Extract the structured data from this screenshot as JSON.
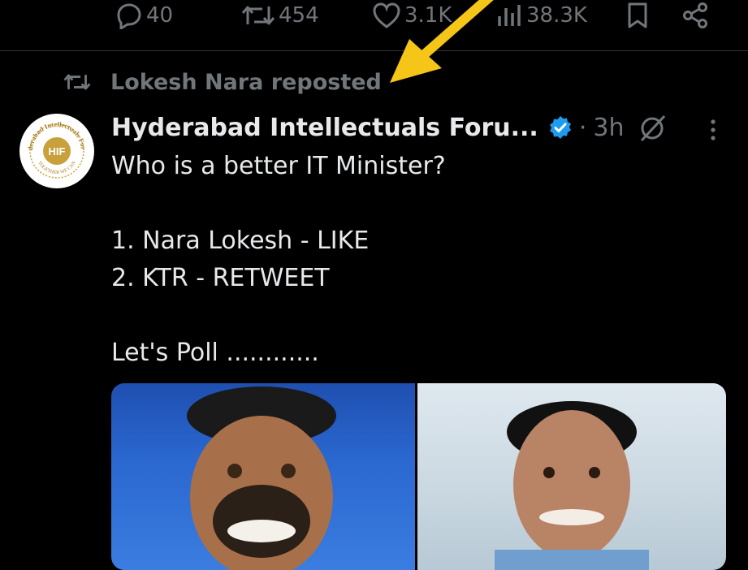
{
  "actions": {
    "replies": "40",
    "reposts": "454",
    "likes": "3.1K",
    "views": "38.3K"
  },
  "repost_banner": "Lokesh Nara reposted",
  "tweet": {
    "author": "Hyderabad Intellectuals Foru...",
    "time": "3h",
    "text": "Who is a better IT Minister?\n\n1. Nara Lokesh - LIKE\n2. KTR - RETWEET\n\nLet's Poll ............",
    "avatar_logo": "HIF",
    "avatar_ring": "Hyderabad Intellectuals Forum",
    "avatar_tagline": "TOGETHER WE CAN"
  },
  "colors": {
    "background": "#000000",
    "text": "#e7e9ea",
    "muted": "#71767b",
    "verified": "#1d9bf0",
    "annotation_arrow": "#f5c518"
  },
  "icons": [
    "reply-icon",
    "repost-icon",
    "like-icon",
    "views-icon",
    "bookmark-icon",
    "share-icon",
    "verified-badge-icon",
    "grok-icon",
    "more-icon"
  ]
}
